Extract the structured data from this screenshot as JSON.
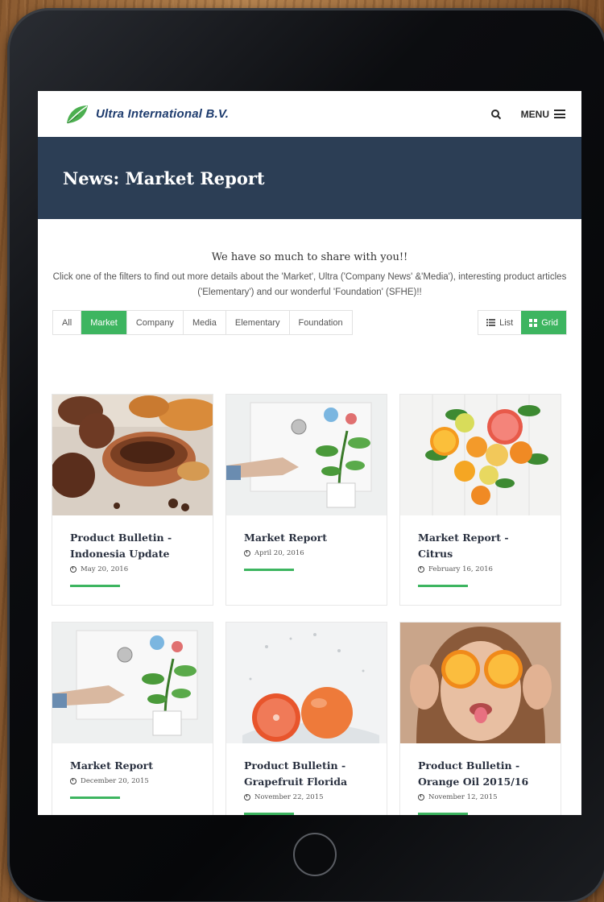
{
  "header": {
    "logo_text": "Ultra International B.V.",
    "menu_label": "MENU"
  },
  "banner": {
    "title": "News: Market Report"
  },
  "intro": {
    "heading": "We have so much to share with you!!",
    "text": "Click one of the filters to find out more details about the 'Market', Ultra ('Company News' &'Media'), interesting product articles ('Elementary') and our wonderful 'Foundation' (SFHE)!!"
  },
  "filters": [
    "All",
    "Market",
    "Company",
    "Media",
    "Elementary",
    "Foundation"
  ],
  "active_filter": "Market",
  "views": {
    "list": "List",
    "grid": "Grid",
    "active": "Grid"
  },
  "cards": [
    {
      "title": "Product Bulletin - Indonesia Update",
      "date": "May 20, 2016",
      "image": "spices"
    },
    {
      "title": "Market Report",
      "date": "April 20, 2016",
      "image": "growth-drawing"
    },
    {
      "title": "Market Report - Citrus",
      "date": "February 16, 2016",
      "image": "citrus-heart"
    },
    {
      "title": "Market Report",
      "date": "December 20, 2015",
      "image": "growth-drawing"
    },
    {
      "title": "Product Bulletin - Grapefruit Florida",
      "date": "November 22, 2015",
      "image": "grapefruit-splash"
    },
    {
      "title": "Product Bulletin - Orange Oil 2015/16",
      "date": "November 12, 2015",
      "image": "orange-eyes"
    }
  ],
  "colors": {
    "accent": "#3db560",
    "banner": "#2c3e55",
    "logo": "#1e3c6e"
  }
}
